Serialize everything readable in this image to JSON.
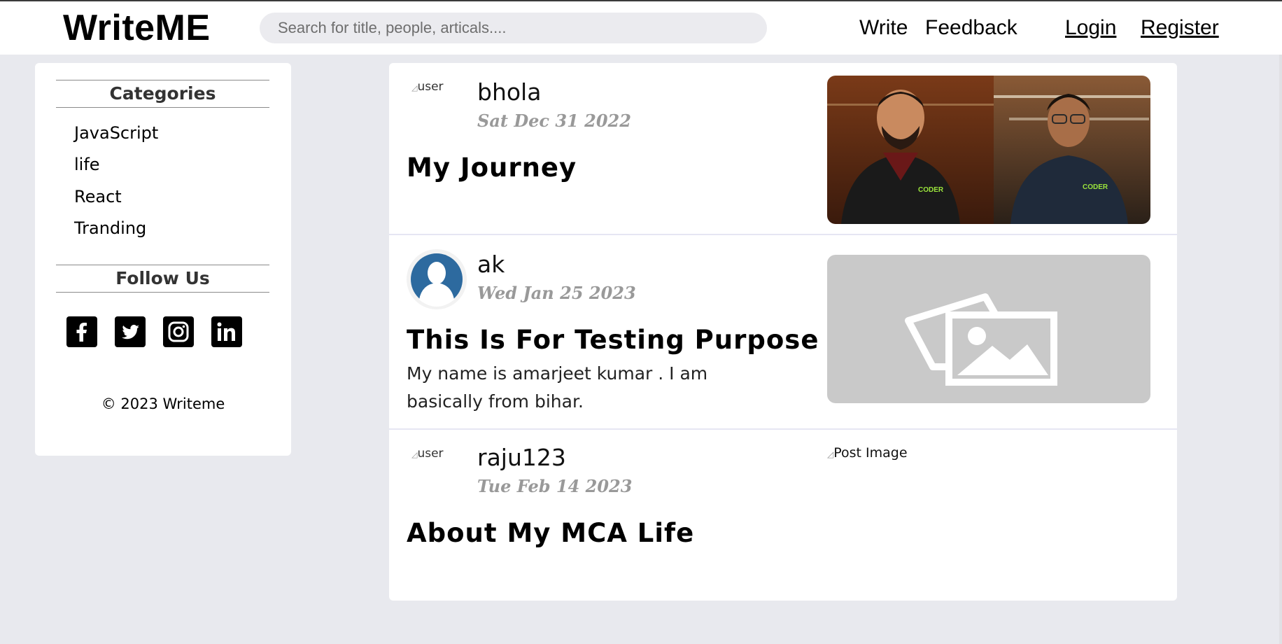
{
  "header": {
    "brand": "WriteME",
    "search_placeholder": "Search for title, people, articals....",
    "nav": {
      "write": "Write",
      "feedback": "Feedback",
      "login": "Login",
      "register": "Register"
    }
  },
  "sidebar": {
    "categories_title": "Categories",
    "categories": [
      "JavaScript",
      "life",
      "React",
      "Tranding"
    ],
    "follow_title": "Follow Us",
    "social_icons": [
      "facebook-icon",
      "twitter-icon",
      "instagram-icon",
      "linkedin-icon"
    ],
    "copyright": "© 2023 Writeme"
  },
  "posts": [
    {
      "avatar_alt": "user",
      "author": "bhola",
      "date": "Sat Dec 31 2022",
      "title": "My Journey",
      "excerpt": "",
      "image": "photo-two-people"
    },
    {
      "avatar_alt": "",
      "author": "ak",
      "date": "Wed Jan 25 2023",
      "title": "This Is For Testing Purpose",
      "excerpt": "My name is amarjeet kumar . I am basically from bihar.",
      "image": "placeholder-image-icon"
    },
    {
      "avatar_alt": "user",
      "author": "raju123",
      "date": "Tue Feb 14 2023",
      "title": "About My MCA Life",
      "excerpt": "",
      "image_alt": "Post Image"
    }
  ]
}
